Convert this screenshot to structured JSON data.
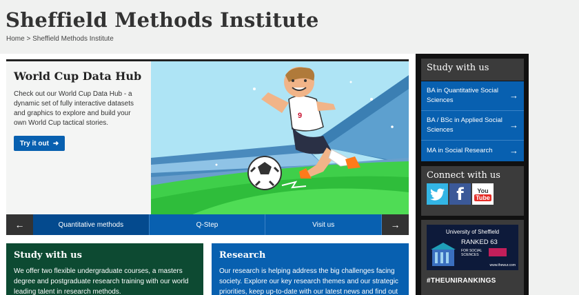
{
  "site": {
    "title": "Sheffield Methods Institute"
  },
  "breadcrumb": {
    "home": "Home",
    "separator": ">",
    "current": "Sheffield Methods Institute"
  },
  "hero": {
    "title": "World Cup Data Hub",
    "description": "Check out our World Cup Data Hub - a dynamic set of fully interactive datasets and graphics to explore and build your own World Cup tactical stories.",
    "button_label": "Try it out",
    "player_number": "9"
  },
  "carousel": {
    "tabs": [
      "Quantitative methods",
      "Q-Step",
      "Visit us"
    ],
    "active_index": 0
  },
  "cards": {
    "study": {
      "title": "Study with us",
      "text": "We offer two flexible undergraduate courses, a masters degree and postgraduate research training with our world leading talent in research methods."
    },
    "research": {
      "title": "Research",
      "text": "Our research is helping address the big challenges facing society. Explore our key research themes and our strategic priorities, keep up-to-date with our latest news and find out"
    }
  },
  "sidebar": {
    "study": {
      "title": "Study with us",
      "items": [
        "BA in Quantitative Social Sciences",
        "BA / BSc in Applied Social Sciences",
        "MA in Social Research"
      ]
    },
    "connect": {
      "title": "Connect with us",
      "youtube_label": "You Tube"
    },
    "ranking": {
      "line1": "University of Sheffield",
      "line2": "RANKED 63",
      "line3": "FOR SOCIAL SCIENCES",
      "site": "www.thewur.com",
      "hashtag": "#THEUNIRANKINGS"
    }
  },
  "colors": {
    "brand_blue": "#0860b0",
    "brand_green": "#0d4a32",
    "sidebar_bg": "#111111"
  }
}
